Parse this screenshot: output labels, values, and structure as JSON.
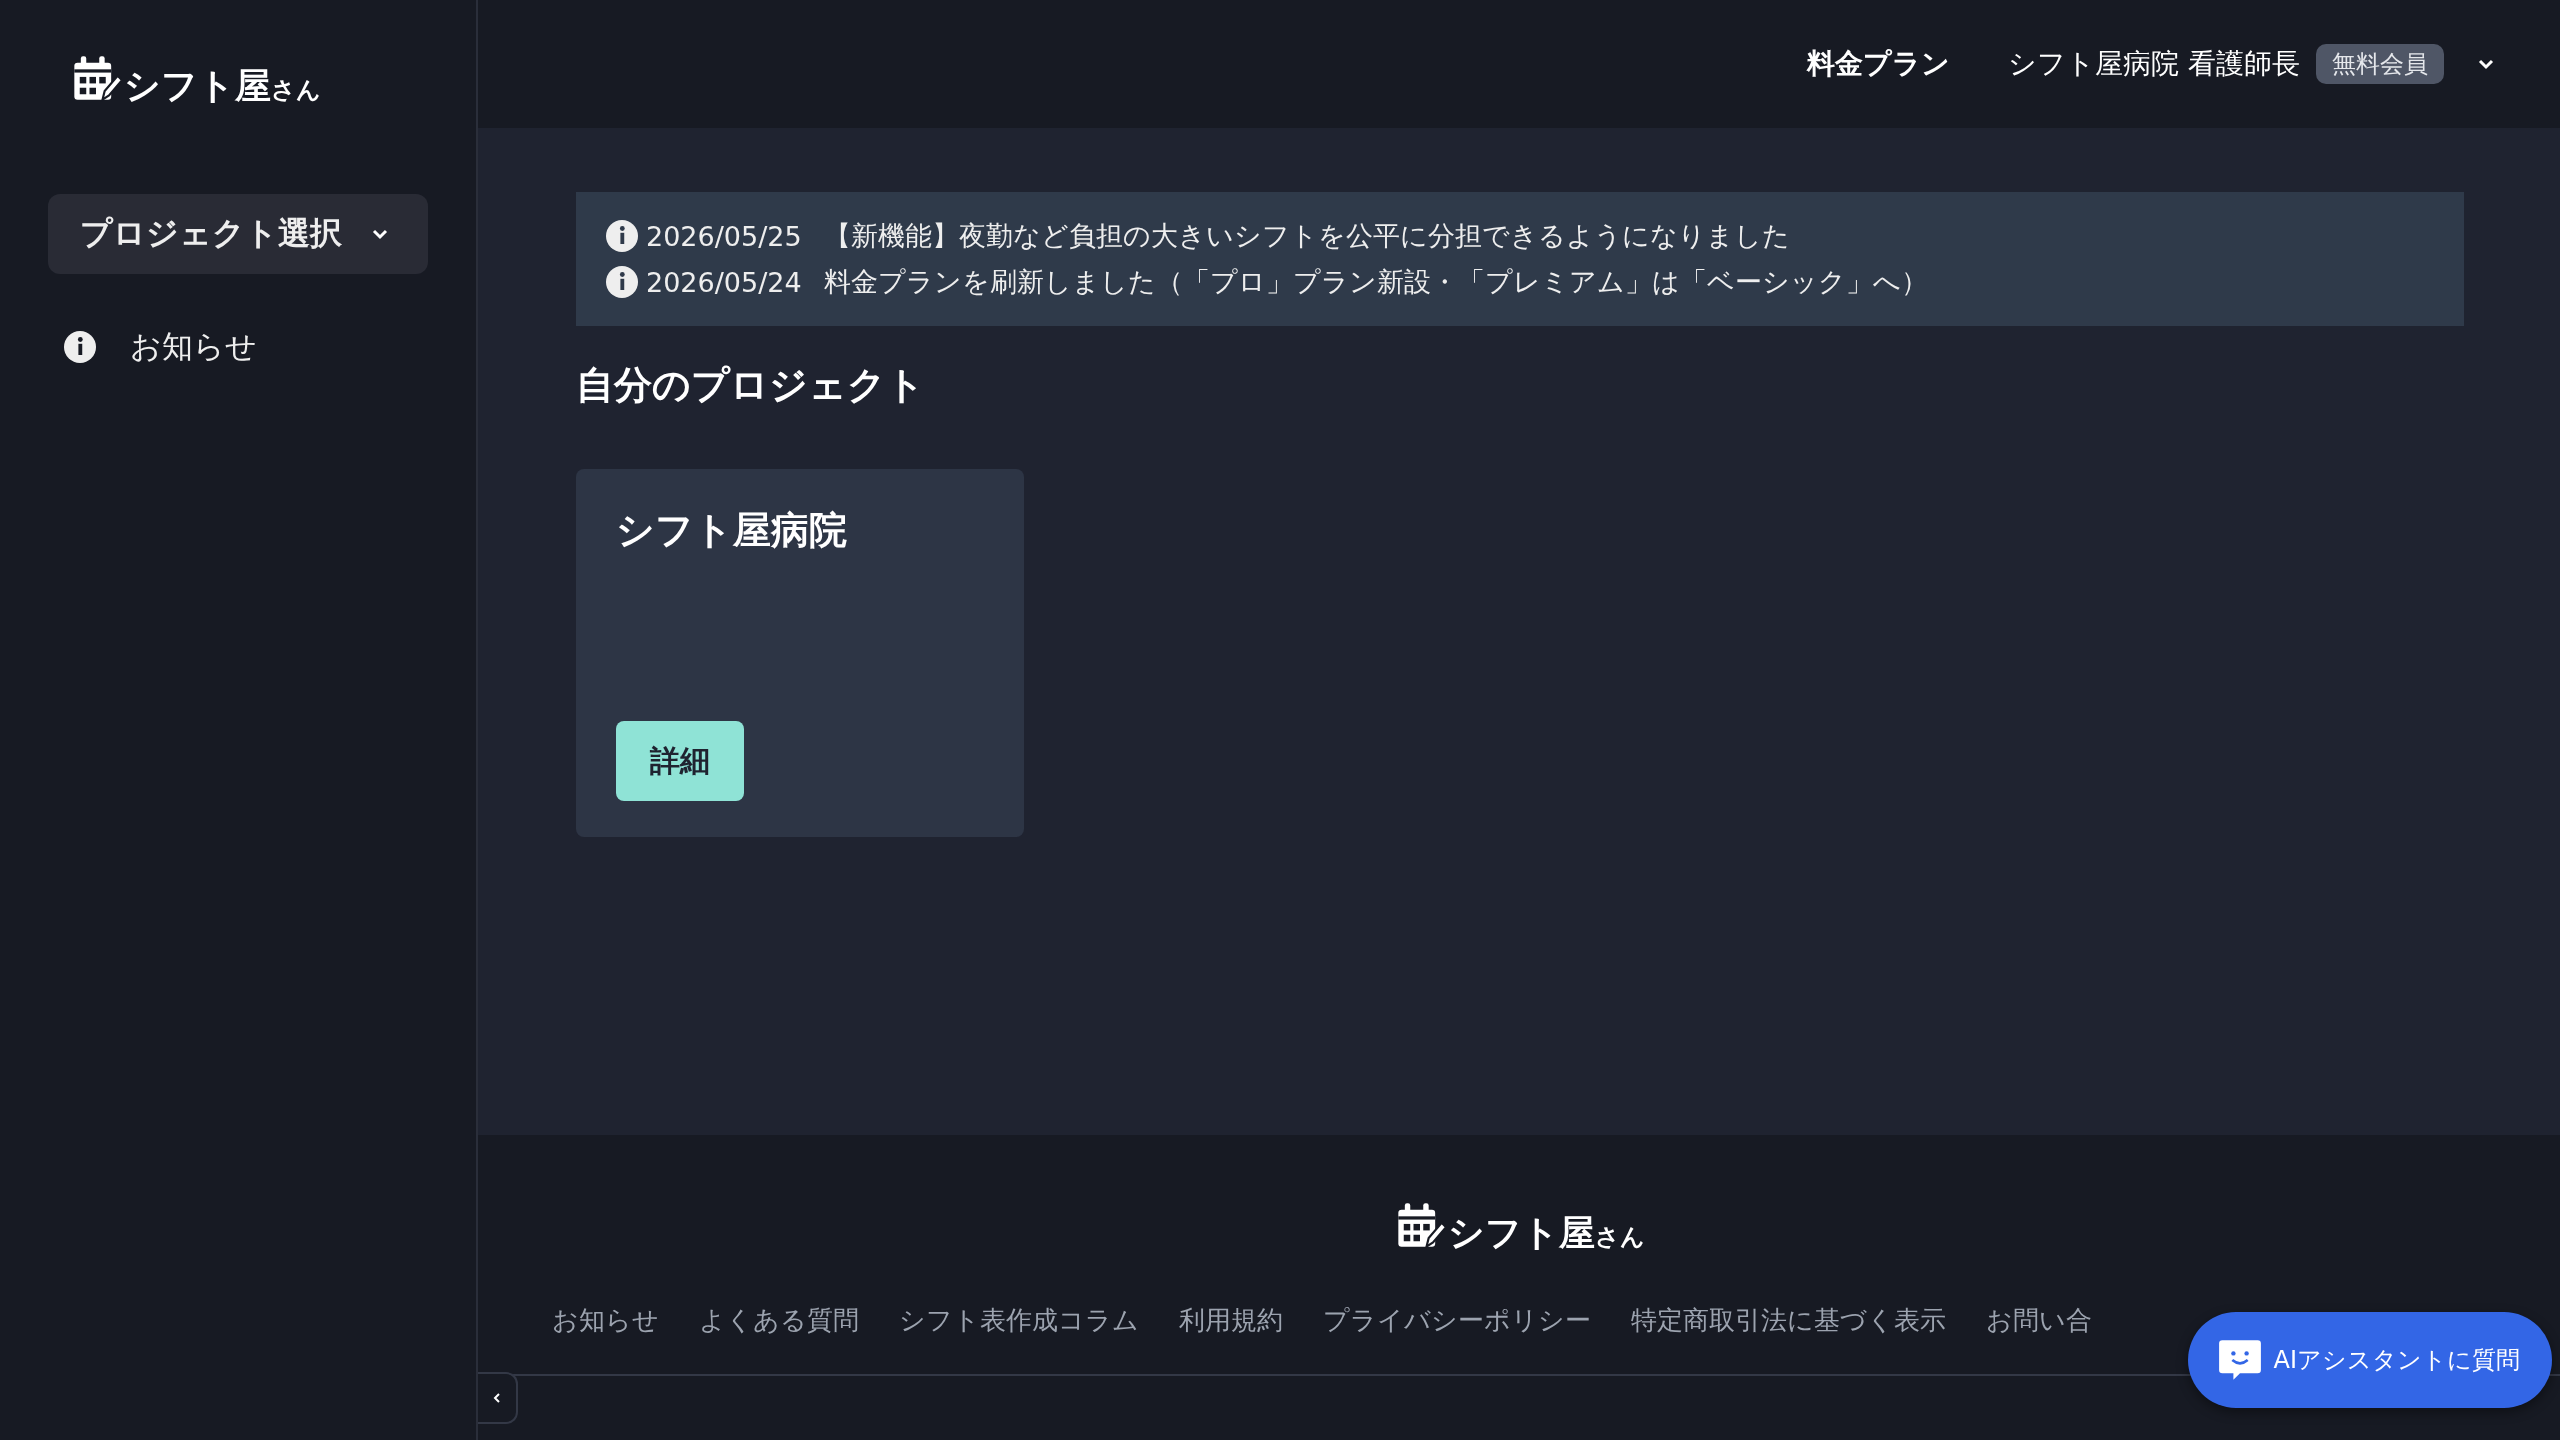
{
  "sidebar": {
    "logo": {
      "main": "シフト屋",
      "suffix": "さん"
    },
    "project_select": {
      "label": "プロジェクト選択",
      "expanded": false
    },
    "items": [
      {
        "label": "お知らせ",
        "selected": false
      }
    ],
    "collapsed": false
  },
  "header": {
    "pricing_link": "料金プラン",
    "user_name": "シフト屋病院 看護師長",
    "membership_badge": "無料会員"
  },
  "notices": [
    {
      "date": "2026/05/25",
      "text": "【新機能】夜勤など負担の大きいシフトを公平に分担できるようになりました"
    },
    {
      "date": "2026/05/24",
      "text": "料金プランを刷新しました（「プロ」プラン新設・「プレミアム」は「ベーシック」へ）"
    }
  ],
  "section_title": "自分のプロジェクト",
  "projects": [
    {
      "name": "シフト屋病院",
      "button": "詳細"
    }
  ],
  "footer": {
    "logo": {
      "main": "シフト屋",
      "suffix": "さん"
    },
    "links": [
      "お知らせ",
      "よくある質問",
      "シフト表作成コラム",
      "利用規約",
      "プライバシーポリシー",
      "特定商取引法に基づく表示",
      "お問い合"
    ]
  },
  "chat_button": "AIアシスタントに質問"
}
